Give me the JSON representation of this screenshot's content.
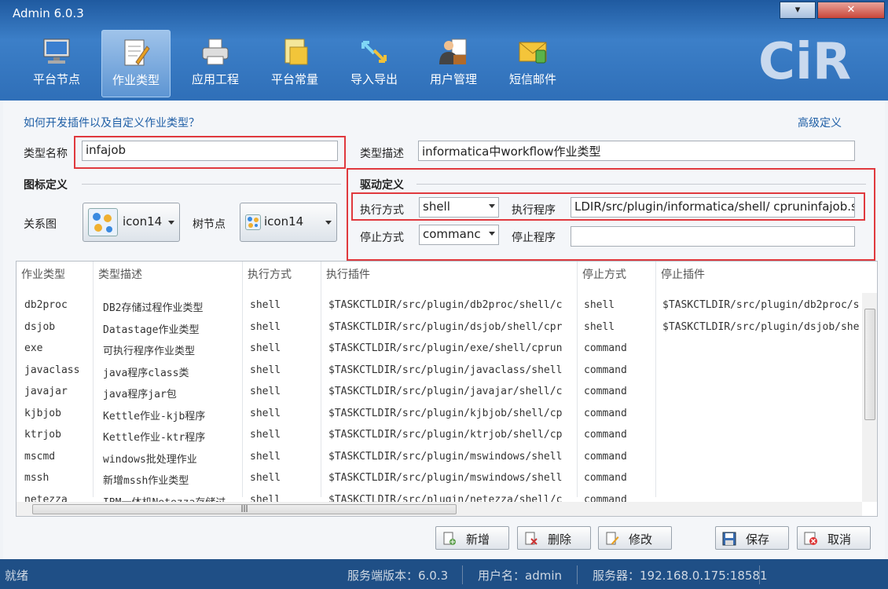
{
  "window": {
    "title": "Admin 6.0.3",
    "min_label": "▾",
    "close_label": "✕"
  },
  "nav": [
    {
      "label": "平台节点",
      "icon": "monitor-icon"
    },
    {
      "label": "作业类型",
      "icon": "document-pen-icon"
    },
    {
      "label": "应用工程",
      "icon": "printer-icon"
    },
    {
      "label": "平台常量",
      "icon": "folder-file-icon"
    },
    {
      "label": "导入导出",
      "icon": "import-export-icon"
    },
    {
      "label": "用户管理",
      "icon": "user-manage-icon"
    },
    {
      "label": "短信邮件",
      "icon": "mail-icon"
    }
  ],
  "logo_text": "CiR",
  "form": {
    "help_link": "如何开发插件以及自定义作业类型？",
    "advanced_link": "高级定义",
    "type_name_label": "类型名称",
    "type_name_value": "infajob",
    "type_desc_label": "类型描述",
    "type_desc_value": "informatica中workflow作业类型",
    "icon_section": "图标定义",
    "driver_section": "驱动定义",
    "relation_label": "关系图",
    "relation_icon": "icon14",
    "tree_label": "树节点",
    "tree_icon": "icon14",
    "exec_mode_label": "执行方式",
    "exec_mode_value": "shell",
    "exec_prog_label": "执行程序",
    "exec_prog_value": "LDIR/src/plugin/informatica/shell/ cpruninfajob.sh",
    "stop_mode_label": "停止方式",
    "stop_mode_value": "commanc",
    "stop_prog_label": "停止程序",
    "stop_prog_value": ""
  },
  "table": {
    "headers": [
      "作业类型",
      "类型描述",
      "执行方式",
      "执行插件",
      "停止方式",
      "停止插件"
    ],
    "rows": [
      [
        "db2proc",
        "DB2存储过程作业类型",
        "shell",
        "$TASKCTLDIR/src/plugin/db2proc/shell/c",
        "shell",
        "$TASKCTLDIR/src/plugin/db2proc/s"
      ],
      [
        "dsjob",
        "Datastage作业类型",
        "shell",
        "$TASKCTLDIR/src/plugin/dsjob/shell/cpr",
        "shell",
        "$TASKCTLDIR/src/plugin/dsjob/she"
      ],
      [
        "exe",
        "可执行程序作业类型",
        "shell",
        "$TASKCTLDIR/src/plugin/exe/shell/cprun",
        "command",
        ""
      ],
      [
        "javaclass",
        "java程序class类",
        "shell",
        "$TASKCTLDIR/src/plugin/javaclass/shell",
        "command",
        ""
      ],
      [
        "javajar",
        "java程序jar包",
        "shell",
        "$TASKCTLDIR/src/plugin/javajar/shell/c",
        "command",
        ""
      ],
      [
        "kjbjob",
        "Kettle作业-kjb程序",
        "shell",
        "$TASKCTLDIR/src/plugin/kjbjob/shell/cp",
        "command",
        ""
      ],
      [
        "ktrjob",
        "Kettle作业-ktr程序",
        "shell",
        "$TASKCTLDIR/src/plugin/ktrjob/shell/cp",
        "command",
        ""
      ],
      [
        "mscmd",
        "windows批处理作业",
        "shell",
        "$TASKCTLDIR/src/plugin/mswindows/shell",
        "command",
        ""
      ],
      [
        "mssh",
        "新增mssh作业类型",
        "shell",
        "$TASKCTLDIR/src/plugin/mswindows/shell",
        "command",
        ""
      ],
      [
        "netezza",
        "IBM一体机Netezza存储过",
        "shell",
        "$TASKCTLDIR/src/plugin/netezza/shell/c",
        "command",
        ""
      ]
    ]
  },
  "buttons": {
    "add": "新增",
    "delete": "删除",
    "edit": "修改",
    "save": "保存",
    "cancel": "取消"
  },
  "status": {
    "left": "就绪",
    "server_version": "服务端版本：6.0.3",
    "username": "用户名：admin",
    "server": "服务器：192.168.0.175:18581"
  }
}
